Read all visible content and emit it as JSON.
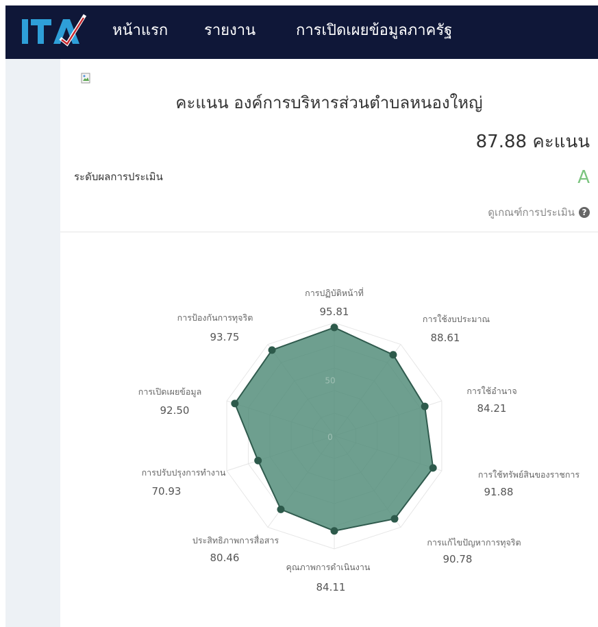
{
  "nav": {
    "logo_text": "ITA",
    "items": [
      "หน้าแรก",
      "รายงาน",
      "การเปิดเผยข้อมูลภาครัฐ"
    ]
  },
  "header": {
    "title": "คะแนน องค์การบริหารส่วนตำบลหนองใหญ่",
    "score": "87.88 คะแนน",
    "level_label": "ระดับผลการประเมิน",
    "grade": "A",
    "criteria_link": "ดูเกณฑ์การประเมิน"
  },
  "colors": {
    "navbar": "#0f1738",
    "fill": "#4e8a76",
    "grade": "#7bc47f"
  },
  "chart_data": {
    "type": "radar",
    "title": "",
    "scale_min": 0,
    "scale_max": 100,
    "ticks": [
      0,
      50
    ],
    "categories": [
      "การปฏิบัติหน้าที่",
      "การใช้งบประมาณ",
      "การใช้อำนาจ",
      "การใช้ทรัพย์สินของราชการ",
      "การแก้ไขปัญหาการทุจริต",
      "คุณภาพการดำเนินงาน",
      "ประสิทธิภาพการสื่อสาร",
      "การปรับปรุงการทำงาน",
      "การเปิดเผยข้อมูล",
      "การป้องกันการทุจริต"
    ],
    "values": [
      95.81,
      88.61,
      84.21,
      91.88,
      90.78,
      84.11,
      80.46,
      70.93,
      92.5,
      93.75
    ],
    "value_labels": [
      "95.81",
      "88.61",
      "84.21",
      "91.88",
      "90.78",
      "84.11",
      "80.46",
      "70.93",
      "92.50",
      "93.75"
    ]
  }
}
